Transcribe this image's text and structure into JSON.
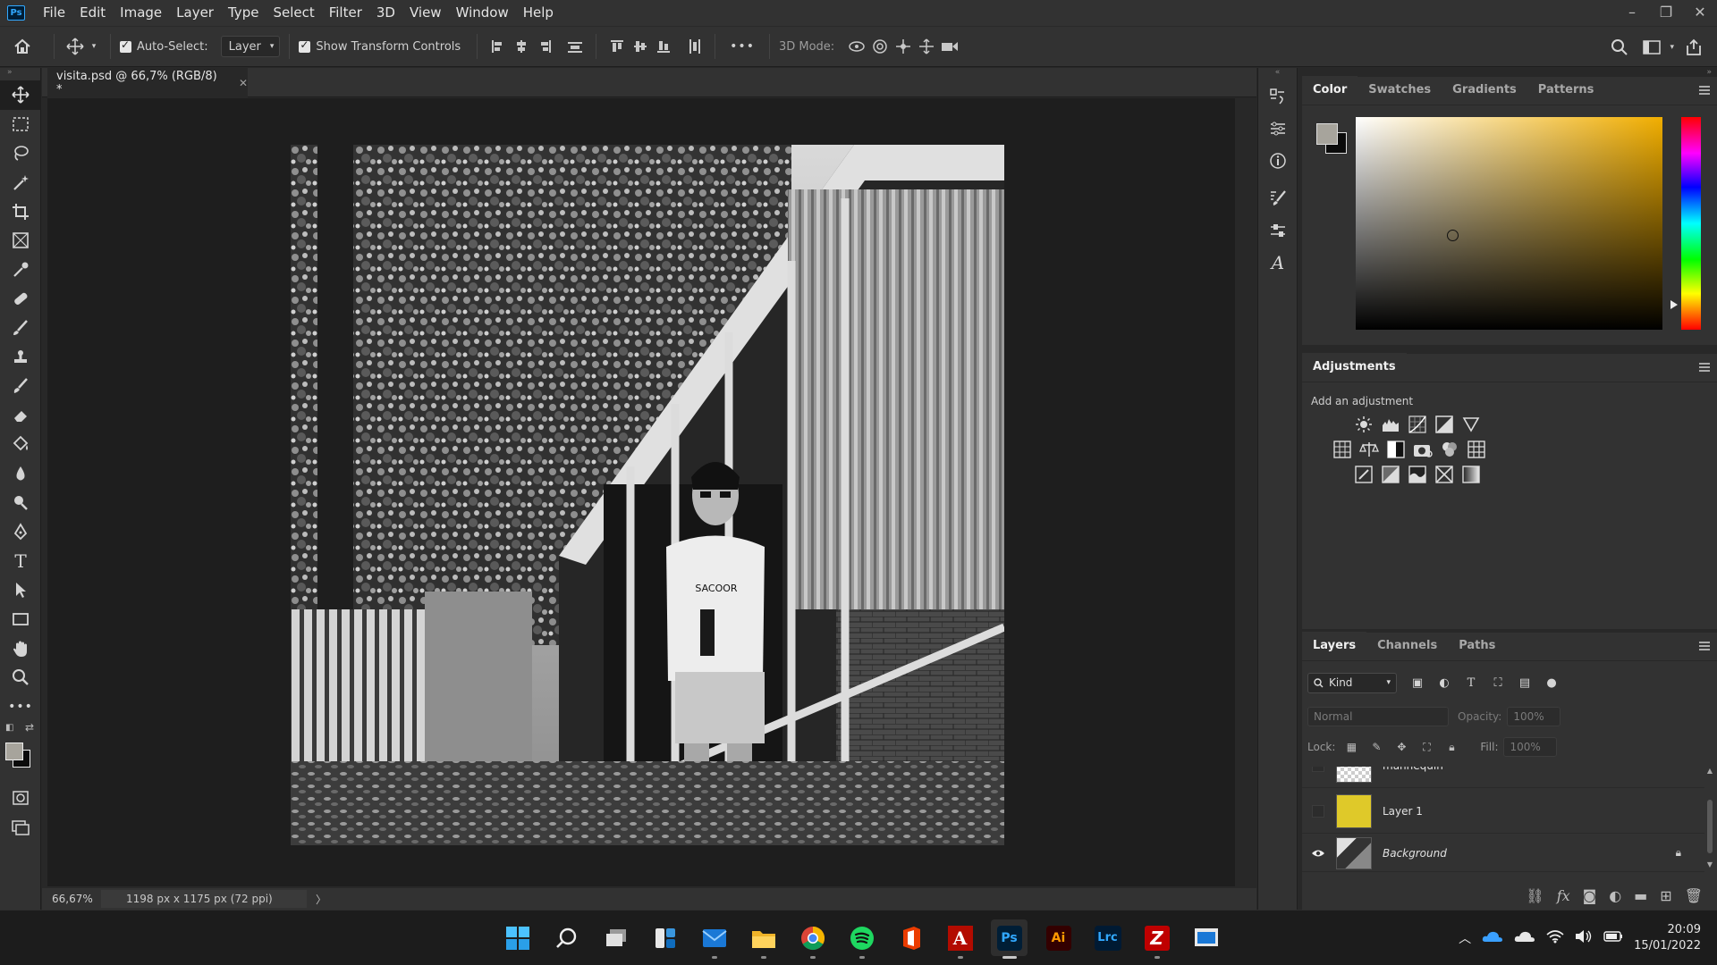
{
  "app": {
    "logo": "Ps",
    "menu": [
      "File",
      "Edit",
      "Image",
      "Layer",
      "Type",
      "Select",
      "Filter",
      "3D",
      "View",
      "Window",
      "Help"
    ],
    "window_controls": [
      "minimize-icon",
      "restore-icon",
      "close-icon"
    ]
  },
  "options_bar": {
    "auto_select_label": "Auto-Select:",
    "auto_select_checked": true,
    "auto_select_target": "Layer",
    "show_transform_label": "Show Transform Controls",
    "show_transform_checked": true,
    "more_label": "•••",
    "mode_3d_label": "3D Mode:"
  },
  "document": {
    "tab_title": "visita.psd @ 66,7% (RGB/8) *",
    "zoom": "66,67%",
    "doc_info": "1198 px x 1175 px (72 ppi)"
  },
  "toolbar": {
    "tools": [
      "move-tool-icon",
      "marquee-tool-icon",
      "lasso-tool-icon",
      "magic-wand-icon",
      "crop-tool-icon",
      "frame-tool-icon",
      "eyedropper-icon",
      "healing-brush-icon",
      "brush-tool-icon",
      "clone-stamp-icon",
      "history-brush-icon",
      "eraser-icon",
      "paint-bucket-icon",
      "blur-tool-icon",
      "dodge-tool-icon",
      "pen-tool-icon",
      "type-tool-icon",
      "path-select-icon",
      "rectangle-tool-icon",
      "hand-tool-icon",
      "zoom-tool-icon",
      "more-tools-icon"
    ],
    "more_label": "•••",
    "foreground_color": "#a7a49c",
    "background_color": "#0b0b0b"
  },
  "color_panel": {
    "tabs": [
      "Color",
      "Swatches",
      "Gradients",
      "Patterns"
    ],
    "active_tab": "Color",
    "foreground_color": "#a7a49c",
    "background_color": "#0b0b0b",
    "hue_color": "#f1ae00"
  },
  "adjustments_panel": {
    "tab": "Adjustments",
    "hint": "Add an adjustment",
    "icons_row1": [
      "brightness-contrast-icon",
      "levels-icon",
      "curves-icon",
      "exposure-icon",
      "vibrance-icon"
    ],
    "icons_row2": [
      "hue-saturation-icon",
      "color-balance-icon",
      "black-white-icon",
      "photo-filter-icon",
      "channel-mixer-icon",
      "color-lookup-icon"
    ],
    "icons_row3": [
      "invert-icon",
      "posterize-icon",
      "threshold-icon",
      "selective-color-icon",
      "gradient-map-icon"
    ]
  },
  "layers_panel": {
    "tabs": [
      "Layers",
      "Channels",
      "Paths"
    ],
    "active_tab": "Layers",
    "filter_kind": "Kind",
    "blend_mode": "Normal",
    "opacity_label": "Opacity:",
    "opacity_value": "100%",
    "lock_label": "Lock:",
    "fill_label": "Fill:",
    "fill_value": "100%",
    "layers": [
      {
        "name": "mannequin",
        "visible": false,
        "thumb": "transparent"
      },
      {
        "name": "Layer 1",
        "visible": false,
        "thumb": "#dfc929"
      },
      {
        "name": "Background",
        "visible": true,
        "thumb": "photo",
        "locked": true
      }
    ]
  },
  "taskbar": {
    "apps": [
      "windows-start-icon",
      "search-icon",
      "task-view-icon",
      "widgets-icon",
      "mail-icon",
      "file-explorer-icon",
      "chrome-icon",
      "spotify-icon",
      "office-icon",
      "acrobat-icon",
      "photoshop-icon",
      "illustrator-icon",
      "lightroom-classic-icon",
      "filezilla-icon",
      "remote-desktop-icon"
    ],
    "app_labels": {
      "photoshop": "Ps",
      "illustrator": "Ai",
      "lightroom": "Lrc",
      "acrobat": "A"
    },
    "tray_icons": [
      "chevron-up-icon",
      "onedrive-icon",
      "cloud-icon",
      "wifi-icon",
      "volume-icon",
      "battery-icon"
    ],
    "time": "20:09",
    "date": "15/01/2022"
  }
}
